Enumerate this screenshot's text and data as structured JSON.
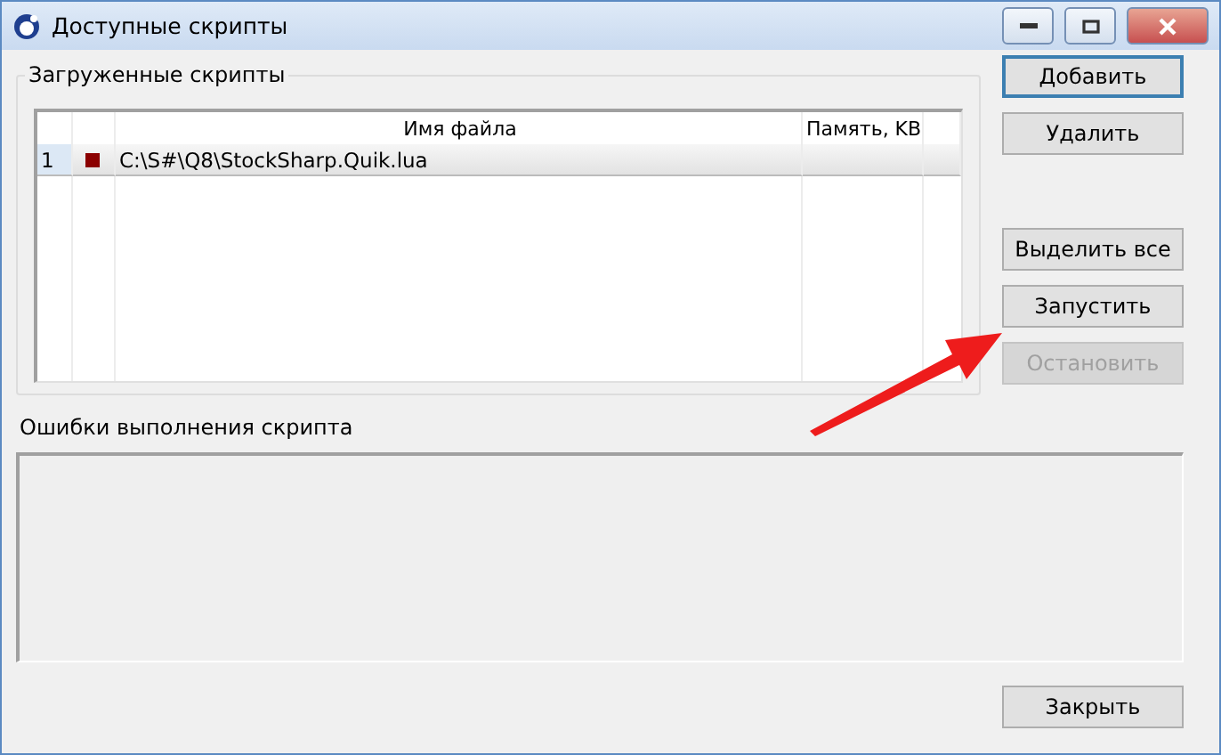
{
  "window": {
    "title": "Доступные скрипты"
  },
  "loaded_scripts": {
    "title": "Загруженные скрипты",
    "columns": [
      "Имя файла",
      "Память, KB"
    ],
    "rows": [
      {
        "number": "1",
        "color": "#8b0000",
        "file": "C:\\S#\\Q8\\StockSharp.Quik.lua",
        "selected": true
      }
    ]
  },
  "errors": {
    "title": "Ошибки выполнения скрипта"
  },
  "buttons": [
    {
      "label": "Добавить",
      "focused": true,
      "disabled": false
    },
    {
      "label": "Удалить",
      "focused": false,
      "disabled": false
    },
    {
      "label": "Выделить все",
      "focused": false,
      "disabled": false
    },
    {
      "label": "Запустить",
      "focused": false,
      "disabled": false
    },
    {
      "label": "Остановить",
      "focused": false,
      "disabled": true
    }
  ],
  "close_button": {
    "label": "Закрыть"
  }
}
